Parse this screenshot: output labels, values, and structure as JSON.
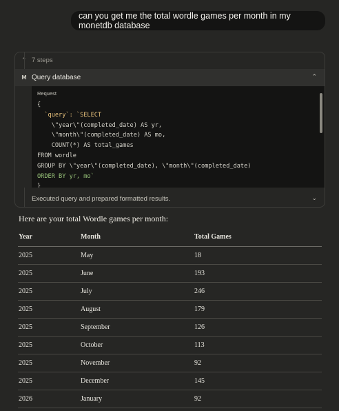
{
  "user_message": "can you get me the total wordle games per month in my monetdb database",
  "steps": {
    "label": "7 steps"
  },
  "tool_call": {
    "badge": "M",
    "title": "Query database",
    "request_label": "Request",
    "code_lines": [
      [
        "{",
        "plain"
      ],
      [
        "  `query`: `SELECT",
        "key"
      ],
      [
        "    \\\"year\\\"(completed_date) AS yr,",
        "plain"
      ],
      [
        "    \\\"month\\\"(completed_date) AS mo,",
        "plain"
      ],
      [
        "    COUNT(*) AS total_games",
        "plain"
      ],
      [
        "FROM wordle",
        "plain"
      ],
      [
        "GROUP BY \\\"year\\\"(completed_date), \\\"month\\\"(completed_date)",
        "plain"
      ],
      [
        "ORDER BY yr, mo`",
        "kw"
      ],
      [
        "}",
        "plain"
      ]
    ],
    "result_label": "Executed query and prepared formatted results."
  },
  "response": {
    "intro": "Here are your total Wordle games per month:",
    "columns": [
      "Year",
      "Month",
      "Total Games"
    ],
    "rows": [
      [
        "2025",
        "May",
        "18"
      ],
      [
        "2025",
        "June",
        "193"
      ],
      [
        "2025",
        "July",
        "246"
      ],
      [
        "2025",
        "August",
        "179"
      ],
      [
        "2025",
        "September",
        "126"
      ],
      [
        "2025",
        "October",
        "113"
      ],
      [
        "2025",
        "November",
        "92"
      ],
      [
        "2025",
        "December",
        "145"
      ],
      [
        "2026",
        "January",
        "92"
      ]
    ]
  }
}
